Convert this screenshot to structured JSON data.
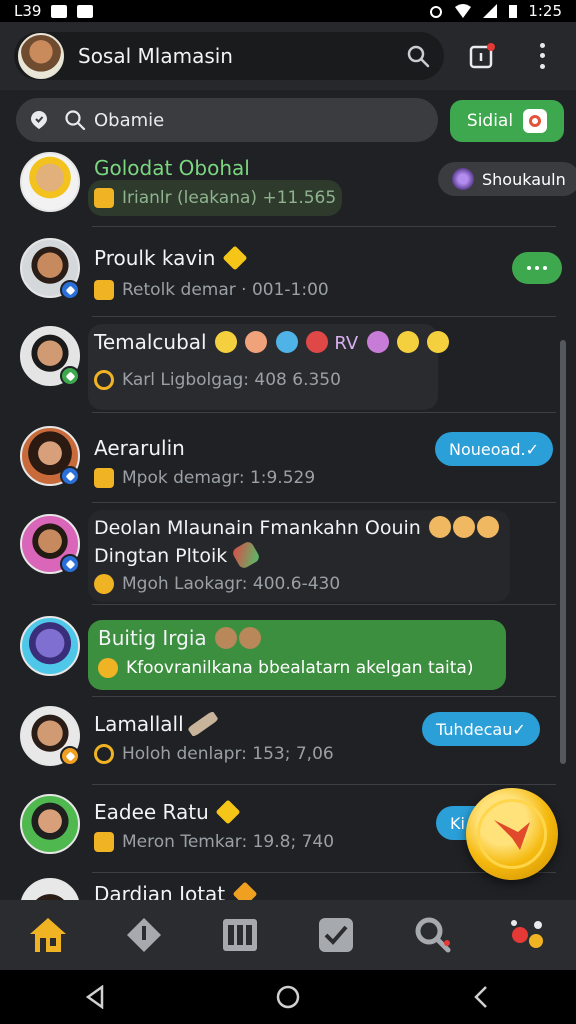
{
  "status_bar": {
    "left_text": "L39",
    "time": "1:25"
  },
  "header": {
    "title": "Sosal Mlamasin"
  },
  "search": {
    "placeholder": "Obamie",
    "action_label": "Sidial"
  },
  "chats": [
    {
      "name": "Golodat Obohal",
      "subtitle": "Irianlr (leakana) +11.565",
      "chip": "Shoukauln",
      "highlighted": true
    },
    {
      "name": "Proulk kavin",
      "subtitle": "Retolk demar · 001-1:00",
      "has_more_button": true
    },
    {
      "name": "Temalcubal",
      "name_suffix": "RV",
      "subtitle": "Karl Ligbolgag: 408 6.350"
    },
    {
      "name": "Aerarulin",
      "subtitle": "Mpok demagr: 1:9.529",
      "chip": "Noueoad.✓"
    },
    {
      "name": "Deolan Mlaunain Fmankahn Oouin",
      "name_line2": "Dingtan Pltoik",
      "subtitle": "Mgoh Laokagr: 400.6-430"
    },
    {
      "name": "Buitig Irgia",
      "subtitle": "Kfoovranilkana bbealatarn akelgan taita)",
      "highlighted": true
    },
    {
      "name": "Lamallall",
      "subtitle": "Holoh denlapr: 153; 7,06",
      "chip": "Tuhdecau✓"
    },
    {
      "name": "Eadee Ratu",
      "subtitle": "Meron Temkar: 19.8; 740",
      "chip": "Ki"
    },
    {
      "name": "Dardian Iotat"
    }
  ],
  "colors": {
    "accent_green": "#3ea84e",
    "chip_blue": "#2b9fd8",
    "background": "#1f2124",
    "fab_gold": "#f5b90f"
  },
  "bottom_nav": [
    "home-icon",
    "tag-icon",
    "calendar-icon",
    "checkbox-icon",
    "search-icon",
    "games-icon"
  ]
}
